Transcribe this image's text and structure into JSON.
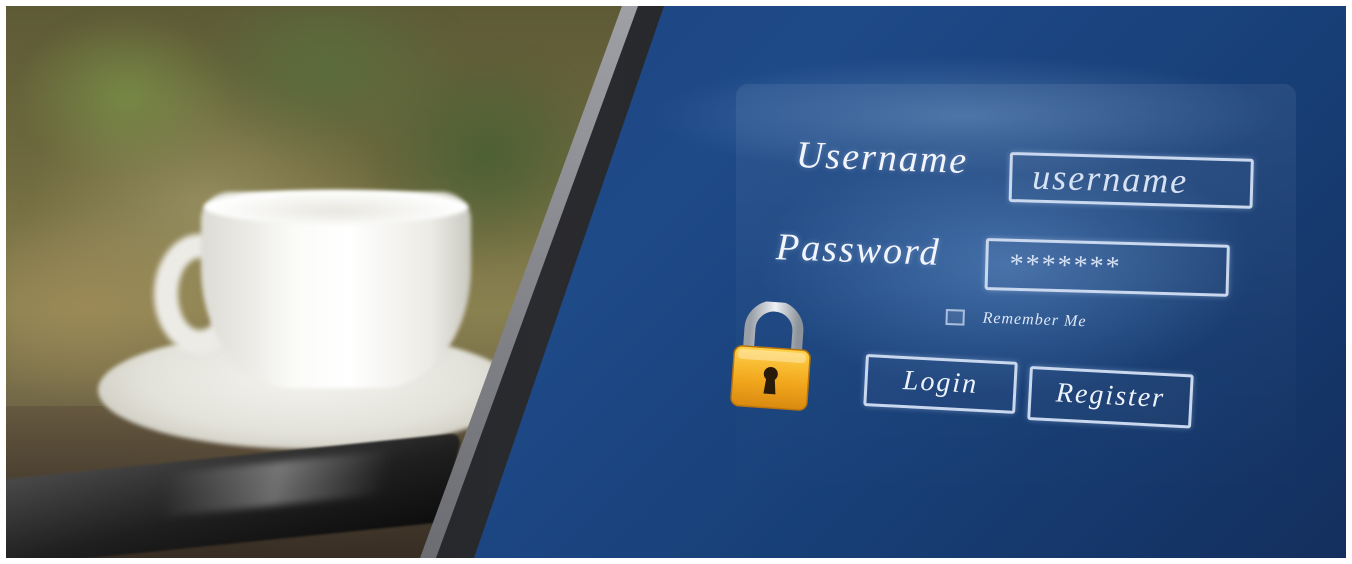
{
  "scene": {
    "description_icon": "padlock-icon"
  },
  "login_form": {
    "username_label": "Username",
    "username_value": "username",
    "password_label": "Password",
    "password_value": "*******",
    "remember_label": "Remember Me",
    "remember_checked": false,
    "login_label": "Login",
    "register_label": "Register"
  },
  "colors": {
    "screen_blue": "#1e4a88",
    "field_outline": "#c9d8ee",
    "padlock_gold": "#f2a81d",
    "padlock_shackle": "#c9cdd2"
  }
}
